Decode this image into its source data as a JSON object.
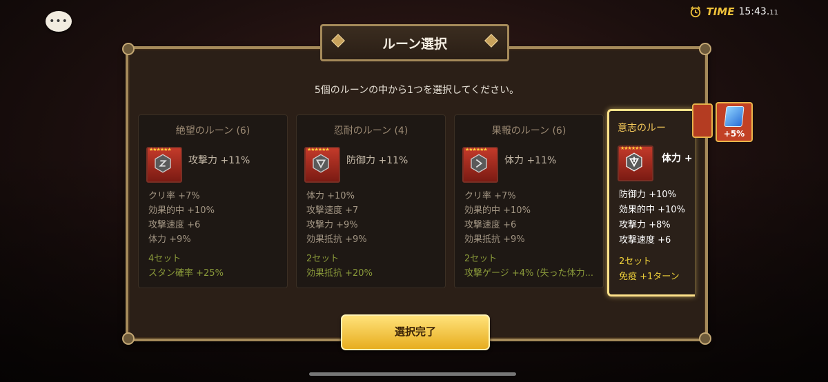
{
  "status_bar": {
    "time_label": "TIME",
    "time": "15:43.",
    "time_fraction": "11",
    "clock_icon": "alarm-clock-icon"
  },
  "chat_button": {
    "icon": "speech-bubble-icon",
    "glyph": "•••"
  },
  "dialog": {
    "title": "ルーン選択",
    "instruction": "5個のルーンの中から1つを選択してください。",
    "confirm_label": "選択完了"
  },
  "runes": [
    {
      "name": "絶望のルーン (6)",
      "stars": "★★★★★★",
      "main_stat": "攻撃力 +11%",
      "subs": [
        "クリ率 +7%",
        "効果的中 +10%",
        "攻撃速度 +6",
        "体力 +9%"
      ],
      "set_count": "4セット",
      "set_effect": "スタン確率 +25%",
      "selected": false
    },
    {
      "name": "忍耐のルーン (4)",
      "stars": "★★★★★★",
      "main_stat": "防御力 +11%",
      "subs": [
        "体力 +10%",
        "攻撃速度 +7",
        "攻撃力 +9%",
        "効果抵抗 +9%"
      ],
      "set_count": "2セット",
      "set_effect": "効果抵抗 +20%",
      "selected": false
    },
    {
      "name": "果報のルーン (6)",
      "stars": "★★★★★★",
      "main_stat": "体力 +11%",
      "subs": [
        "クリ率 +7%",
        "効果的中 +10%",
        "攻撃速度 +6",
        "効果抵抗 +9%"
      ],
      "set_count": "2セット",
      "set_effect": "攻撃ゲージ +4% (失った体力...",
      "selected": false
    },
    {
      "name": "意志のルー",
      "stars": "★★★★★★",
      "main_stat": "体力 +",
      "subs": [
        "防御力 +10%",
        "効果的中 +10%",
        "攻撃力 +8%",
        "攻撃速度 +6"
      ],
      "set_count": "2セット",
      "set_effect": "免疫 +1ターン",
      "selected": true
    }
  ],
  "bonus_badge": {
    "label": "+5%",
    "icon": "blue-gem-icon"
  },
  "colors": {
    "panel_border": "#a58a5a",
    "selected_border": "#ffe28a",
    "set_text": "#8a9a3a",
    "button": "#e7ad1f"
  }
}
